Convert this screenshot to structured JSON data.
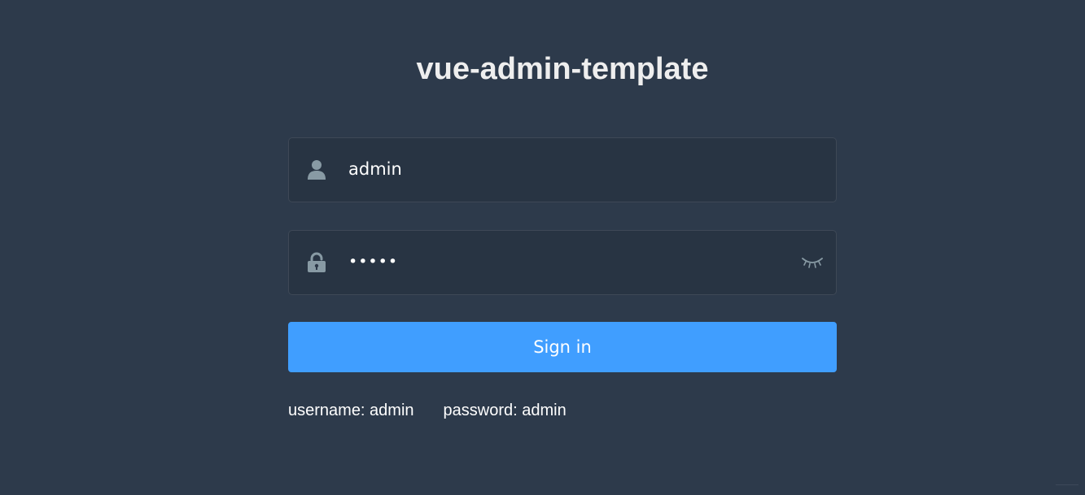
{
  "app": {
    "title": "vue-admin-template"
  },
  "form": {
    "username": {
      "value": "admin",
      "icon": "user-icon"
    },
    "password": {
      "value": "admin",
      "icon": "lock-icon",
      "toggle_icon": "eye-closed-icon"
    },
    "signin_label": "Sign in"
  },
  "tips": {
    "username": "username: admin",
    "password": "password: admin"
  },
  "colors": {
    "background": "#2d3a4b",
    "primary": "#409eff",
    "icon": "#889aa4",
    "title": "#eeeeee"
  }
}
